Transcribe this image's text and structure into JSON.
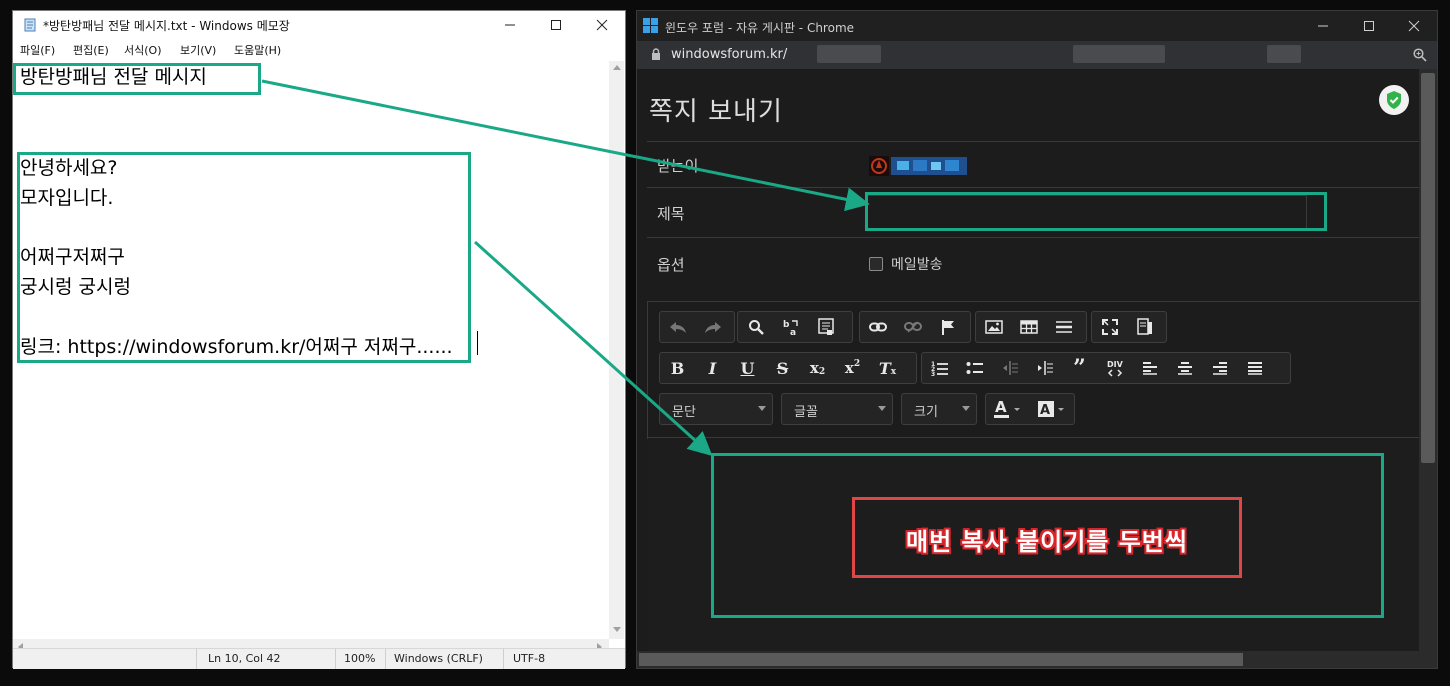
{
  "notepad": {
    "title": "*방탄방패님 전달 메시지.txt - Windows 메모장",
    "menus": [
      "파일(F)",
      "편집(E)",
      "서식(O)",
      "보기(V)",
      "도움말(H)"
    ],
    "lines": {
      "title_line": "방탄방패님 전달 메시지",
      "l1": "안녕하세요?",
      "l2": "모자입니다.",
      "l3": "어쩌구저쩌구",
      "l4": "궁시렁 궁시렁",
      "l5": "링크: https://windowsforum.kr/어쩌구 저쩌구......"
    },
    "status": {
      "position": "Ln 10, Col 42",
      "zoom": "100%",
      "line_ending": "Windows (CRLF)",
      "encoding": "UTF-8"
    }
  },
  "chrome": {
    "title": "윈도우 포럼 - 자유 게시판 - Chrome",
    "url": "windowsforum.kr/",
    "page_title": "쪽지 보내기",
    "fields": {
      "recipient_label": "받는이",
      "subject_label": "제목",
      "subject_value": "",
      "options_label": "옵션",
      "email_checkbox_label": "메일발송",
      "email_checked": false
    },
    "editor": {
      "combo_paragraph": "문단",
      "combo_font": "글꼴",
      "combo_size": "크기",
      "body_text": ""
    }
  },
  "annotation": {
    "note": "매번 복사 붙이기를 두번씩",
    "green": "#1aa886",
    "red": "#e04646"
  }
}
